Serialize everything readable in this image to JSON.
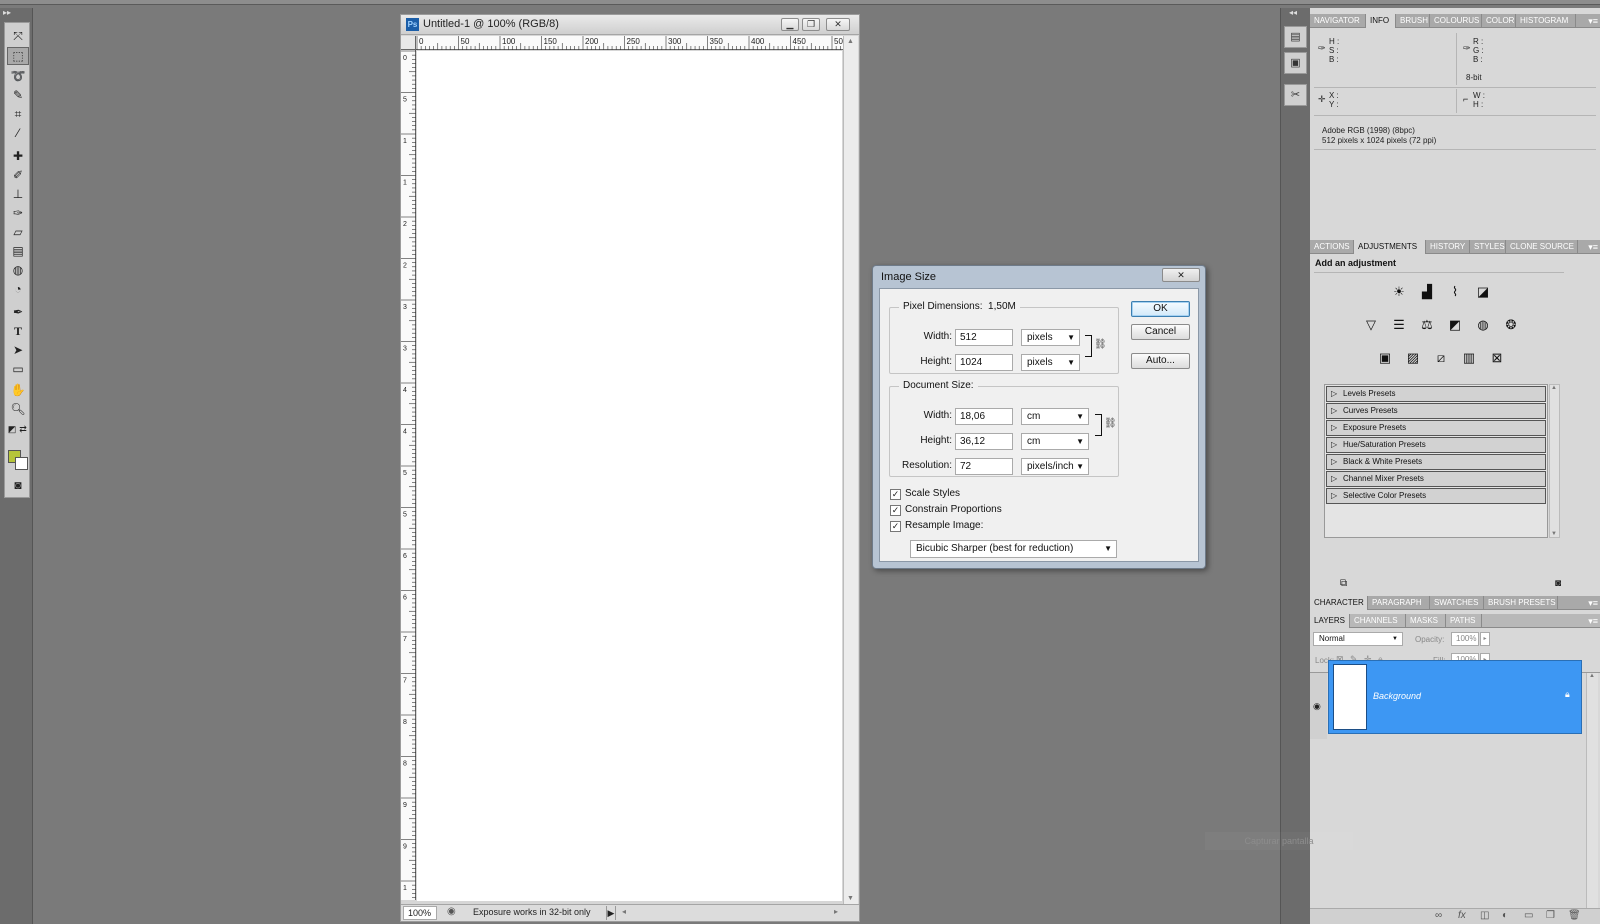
{
  "document": {
    "title": "Untitled-1 @ 100% (RGB/8)",
    "app_badge": "Ps",
    "zoom": "100%",
    "status_text": "Exposure works in 32-bit only",
    "ruler_top_labels": [
      "0",
      "50",
      "100",
      "150",
      "200",
      "250",
      "300",
      "350",
      "400",
      "450",
      "50"
    ],
    "ruler_left_labels": [
      "0",
      "5",
      "1",
      "1",
      "2",
      "2",
      "3",
      "3",
      "4",
      "4",
      "5",
      "5",
      "6",
      "6",
      "7",
      "7",
      "8",
      "8",
      "9",
      "9",
      "1"
    ]
  },
  "dialog": {
    "title": "Image Size",
    "close_label": "✕",
    "pixel_dimensions": {
      "legend": "Pixel Dimensions:",
      "size": "1,50M",
      "width_label": "Width:",
      "width_value": "512",
      "width_unit": "pixels",
      "height_label": "Height:",
      "height_value": "1024",
      "height_unit": "pixels"
    },
    "document_size": {
      "legend": "Document Size:",
      "width_label": "Width:",
      "width_value": "18,06",
      "width_unit": "cm",
      "height_label": "Height:",
      "height_value": "36,12",
      "height_unit": "cm",
      "resolution_label": "Resolution:",
      "resolution_value": "72",
      "resolution_unit": "pixels/inch"
    },
    "checkboxes": {
      "scale_styles": "Scale Styles",
      "constrain": "Constrain Proportions",
      "resample": "Resample Image:"
    },
    "resample_method": "Bicubic Sharper (best for reduction)",
    "buttons": {
      "ok": "OK",
      "cancel": "Cancel",
      "auto": "Auto..."
    }
  },
  "panels": {
    "top_tabs": [
      "NAVIGATOR",
      "INFO",
      "BRUSH",
      "COLOURUS",
      "COLOR",
      "HISTOGRAM"
    ],
    "info": {
      "hsb": "H :\nS :\nB :",
      "rgb": "R :\nG :\nB :",
      "bit": "8-bit",
      "xy": "X :\nY :",
      "wh": "W :\nH :",
      "profile": "Adobe RGB (1998) (8bpc)",
      "dimensions": "512 pixels x 1024 pixels (72 ppi)"
    },
    "mid_tabs": [
      "ACTIONS",
      "ADJUSTMENTS",
      "HISTORY",
      "STYLES",
      "CLONE SOURCE"
    ],
    "adjustments_heading": "Add an adjustment",
    "presets": [
      "Levels Presets",
      "Curves Presets",
      "Exposure Presets",
      "Hue/Saturation Presets",
      "Black & White Presets",
      "Channel Mixer Presets",
      "Selective Color Presets"
    ],
    "char_tabs": [
      "CHARACTER",
      "PARAGRAPH",
      "SWATCHES",
      "BRUSH PRESETS"
    ],
    "layer_tabs": [
      "LAYERS",
      "CHANNELS",
      "MASKS",
      "PATHS"
    ],
    "blend_mode": "Normal",
    "opacity_label": "Opacity:",
    "opacity_value": "100%",
    "lock_label": "Lock:",
    "fill_label": "Fill:",
    "fill_value": "100%",
    "layer_name": "Background"
  },
  "watermark": "Capturar pantalla"
}
